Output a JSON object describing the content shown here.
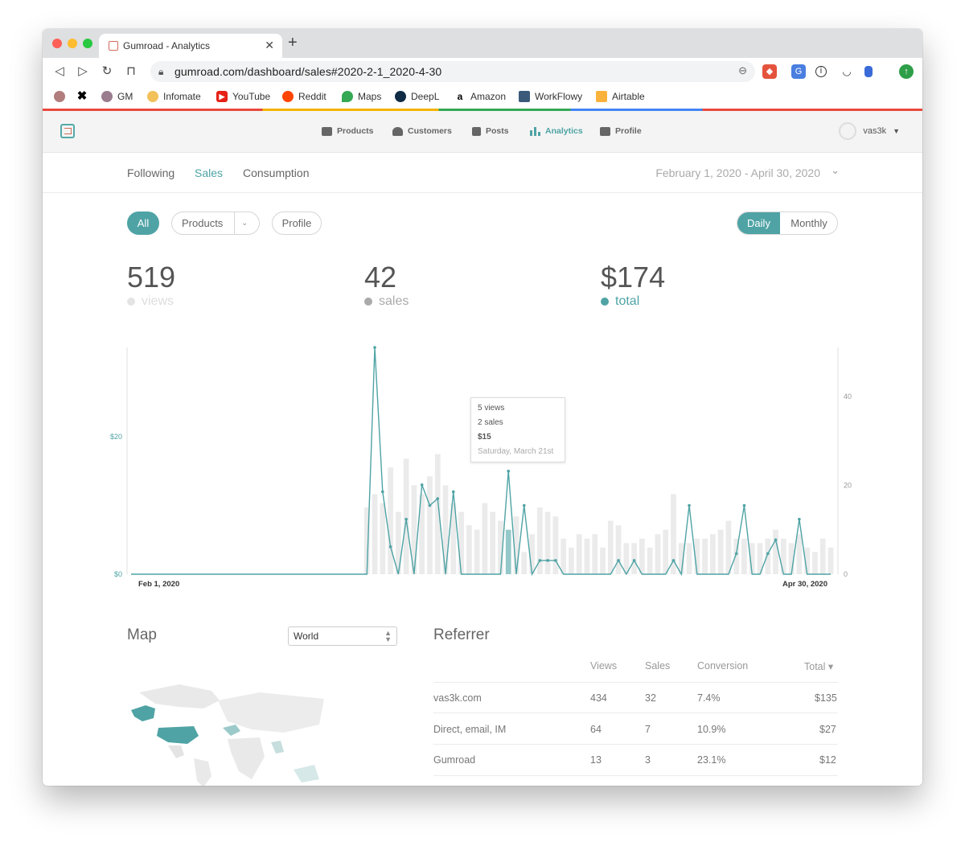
{
  "browser": {
    "tab_title": "Gumroad - Analytics",
    "url": "gumroad.com/dashboard/sales#2020-2-1_2020-4-30",
    "bookmarks": [
      "GM",
      "Infomate",
      "YouTube",
      "Reddit",
      "Maps",
      "DeepL",
      "Amazon",
      "WorkFlowy",
      "Airtable"
    ]
  },
  "app_nav": {
    "items": [
      {
        "label": "Products",
        "icon": "box-icon"
      },
      {
        "label": "Customers",
        "icon": "users-icon"
      },
      {
        "label": "Posts",
        "icon": "document-icon"
      },
      {
        "label": "Analytics",
        "icon": "bar-chart-icon",
        "active": true
      },
      {
        "label": "Profile",
        "icon": "store-icon"
      }
    ],
    "username": "vas3k"
  },
  "subnav": {
    "tabs": [
      "Following",
      "Sales",
      "Consumption"
    ],
    "active_tab": "Sales",
    "date_range": "February 1, 2020 - April 30, 2020"
  },
  "filters": {
    "all": "All",
    "products": "Products",
    "profile": "Profile",
    "daily": "Daily",
    "monthly": "Monthly"
  },
  "stats": [
    {
      "value": "519",
      "label": "views",
      "color": "#dddddd"
    },
    {
      "value": "42",
      "label": "sales",
      "color": "#aaaaaa"
    },
    {
      "value": "$174",
      "label": "total",
      "color": "#4fa3a5"
    }
  ],
  "colors": {
    "accent": "#4fa3a5",
    "bars": "#ebebeb"
  },
  "chart_data": {
    "type": "line",
    "x_start_label": "Feb 1, 2020",
    "x_end_label": "Apr 30, 2020",
    "left_axis": {
      "ticks": [
        "$0",
        "$20"
      ],
      "values": [
        0,
        20
      ],
      "ylim": [
        0,
        33
      ]
    },
    "right_axis": {
      "ticks": [
        "0",
        "20",
        "40"
      ],
      "values": [
        0,
        20,
        40
      ],
      "ylim": [
        0,
        51
      ]
    },
    "days": 90,
    "series": [
      {
        "name": "total",
        "axis": "left",
        "values": [
          0,
          0,
          0,
          0,
          0,
          0,
          0,
          0,
          0,
          0,
          0,
          0,
          0,
          0,
          0,
          0,
          0,
          0,
          0,
          0,
          0,
          0,
          0,
          0,
          0,
          0,
          0,
          0,
          0,
          0,
          0,
          0,
          0,
          0,
          0,
          0,
          0,
          0,
          0,
          0,
          0,
          0,
          0,
          0,
          0,
          0,
          0,
          0,
          0,
          0,
          0,
          0,
          0,
          0,
          0,
          0,
          0,
          0,
          0,
          0,
          0,
          0,
          0,
          0,
          0,
          0,
          0,
          0,
          0,
          0,
          0,
          0,
          0,
          0,
          0,
          0,
          0,
          0,
          0,
          0,
          0,
          0,
          0,
          0,
          0,
          0,
          0,
          0,
          0,
          0
        ]
      },
      {
        "name": "views",
        "axis": "right",
        "values": [
          0,
          0,
          0,
          0,
          0,
          0,
          0,
          0,
          0,
          0,
          0,
          0,
          0,
          0,
          0,
          0,
          0,
          0,
          0,
          0,
          0,
          0,
          0,
          0,
          0,
          0,
          0,
          0,
          0,
          0,
          15,
          18,
          16,
          24,
          14,
          26,
          20,
          18,
          22,
          27,
          20,
          16,
          14,
          11,
          10,
          16,
          14,
          12,
          10,
          13,
          5,
          9,
          15,
          14,
          13,
          8,
          6,
          9,
          8,
          9,
          6,
          12,
          11,
          7,
          7,
          8,
          6,
          9,
          10,
          18,
          7,
          7,
          8,
          8,
          9,
          10,
          12,
          8,
          8,
          7,
          7,
          8,
          10,
          8,
          7,
          9,
          6,
          5,
          8,
          6
        ]
      }
    ],
    "total_points": [
      [
        0,
        0
      ],
      [
        30,
        0
      ],
      [
        31,
        33
      ],
      [
        32,
        12
      ],
      [
        33,
        4
      ],
      [
        34,
        0
      ],
      [
        35,
        8
      ],
      [
        36,
        0
      ],
      [
        37,
        13
      ],
      [
        38,
        10
      ],
      [
        39,
        11
      ],
      [
        40,
        0
      ],
      [
        41,
        12
      ],
      [
        42,
        0
      ],
      [
        43,
        0
      ],
      [
        44,
        0
      ],
      [
        45,
        0
      ],
      [
        46,
        0
      ],
      [
        47,
        0
      ],
      [
        48,
        15
      ],
      [
        49,
        0
      ],
      [
        50,
        10
      ],
      [
        51,
        0
      ],
      [
        52,
        2
      ],
      [
        53,
        2
      ],
      [
        54,
        2
      ],
      [
        55,
        0
      ],
      [
        56,
        0
      ],
      [
        57,
        0
      ],
      [
        58,
        0
      ],
      [
        59,
        0
      ],
      [
        60,
        0
      ],
      [
        61,
        0
      ],
      [
        62,
        2
      ],
      [
        63,
        0
      ],
      [
        64,
        2
      ],
      [
        65,
        0
      ],
      [
        66,
        0
      ],
      [
        67,
        0
      ],
      [
        68,
        0
      ],
      [
        69,
        2
      ],
      [
        70,
        0
      ],
      [
        71,
        10
      ],
      [
        72,
        0
      ],
      [
        73,
        0
      ],
      [
        74,
        0
      ],
      [
        75,
        0
      ],
      [
        76,
        0
      ],
      [
        77,
        3
      ],
      [
        78,
        10
      ],
      [
        79,
        0
      ],
      [
        80,
        0
      ],
      [
        81,
        3
      ],
      [
        82,
        5
      ],
      [
        83,
        0
      ],
      [
        84,
        0
      ],
      [
        85,
        8
      ],
      [
        86,
        0
      ],
      [
        87,
        0
      ],
      [
        88,
        0
      ],
      [
        89,
        0
      ]
    ],
    "highlight_day": 48
  },
  "tooltip": {
    "views": "5 views",
    "sales": "2 sales",
    "total": "$15",
    "date": "Saturday, March 21st"
  },
  "map": {
    "title": "Map",
    "region": "World"
  },
  "referrer": {
    "title": "Referrer",
    "columns": [
      "Views",
      "Sales",
      "Conversion",
      "Total ▾"
    ],
    "rows": [
      {
        "source": "vas3k.com",
        "views": "434",
        "sales": "32",
        "conversion": "7.4%",
        "total": "$135"
      },
      {
        "source": "Direct, email, IM",
        "views": "64",
        "sales": "7",
        "conversion": "10.9%",
        "total": "$27"
      },
      {
        "source": "Gumroad",
        "views": "13",
        "sales": "3",
        "conversion": "23.1%",
        "total": "$12"
      }
    ]
  }
}
